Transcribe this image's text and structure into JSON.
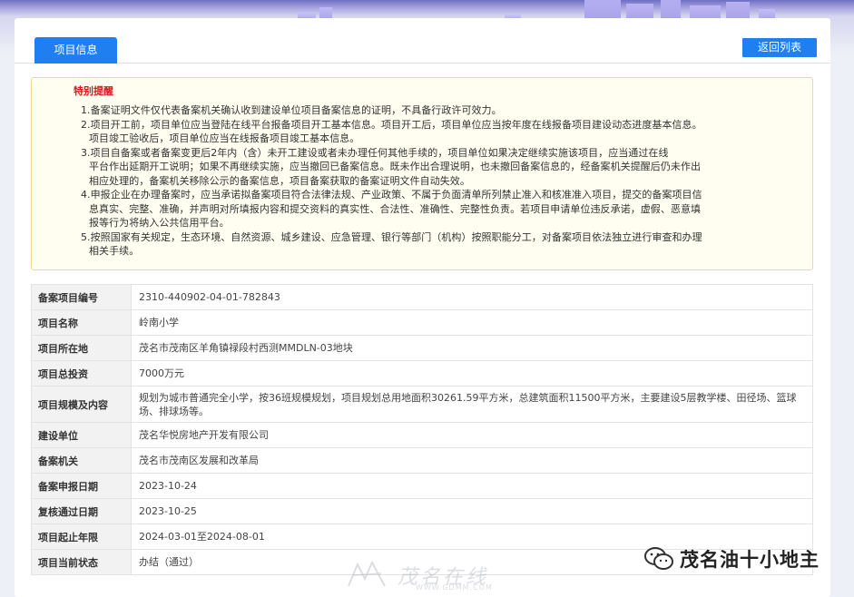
{
  "tabs": {
    "active_label": "项目信息",
    "back_label": "返回列表"
  },
  "notice": {
    "title": "特别提醒",
    "lines": [
      "1.备案证明文件仅代表备案机关确认收到建设单位项目备案信息的证明，不具备行政许可效力。",
      "2.项目开工前，项目单位应当登陆在线平台报备项目开工基本信息。项目开工后，项目单位应当按年度在线报备项目建设动态进度基本信息。",
      "项目竣工验收后，项目单位应当在线报备项目竣工基本信息。",
      "3.项目自备案或者备案变更后2年内（含）未开工建设或者未办理任何其他手续的，项目单位如果决定继续实施该项目，应当通过在线",
      "平台作出延期开工说明；如果不再继续实施，应当撤回已备案信息。既未作出合理说明，也未撤回备案信息的，经备案机关提醒后仍未作出",
      "相应处理的，备案机关移除公示的备案信息，项目备案获取的备案证明文件自动失效。",
      "4.申报企业在办理备案时，应当承诺拟备案项目符合法律法规、产业政策、不属于负面清单所列禁止准入和核准准入项目，提交的备案项目信",
      "息真实、完整、准确，并声明对所填报内容和提交资料的真实性、合法性、准确性、完整性负责。若项目申请单位违反承诺，虚假、恶意填",
      "报等行为将纳入公共信用平台。",
      "5.按照国家有关规定，生态环境、自然资源、城乡建设、应急管理、银行等部门（机构）按照职能分工，对备案项目依法独立进行审查和办理",
      "相关手续。"
    ]
  },
  "info": {
    "rows": [
      {
        "label": "备案项目编号",
        "value": "2310-440902-04-01-782843"
      },
      {
        "label": "项目名称",
        "value": "岭南小学"
      },
      {
        "label": "项目所在地",
        "value": "茂名市茂南区羊角镇禄段村西测MMDLN-03地块"
      },
      {
        "label": "项目总投资",
        "value": "7000万元"
      },
      {
        "label": "项目规模及内容",
        "value": "规划为城市普通完全小学，按36班规模规划，项目规划总用地面积30261.59平方米，总建筑面积11500平方米，主要建设5层教学楼、田径场、篮球场、排球场等。"
      },
      {
        "label": "建设单位",
        "value": "茂名华悦房地产开发有限公司"
      },
      {
        "label": "备案机关",
        "value": "茂名市茂南区发展和改革局"
      },
      {
        "label": "备案申报日期",
        "value": "2023-10-24"
      },
      {
        "label": "复核通过日期",
        "value": "2023-10-25"
      },
      {
        "label": "项目起止年限",
        "value": "2024-03-01至2024-08-01"
      },
      {
        "label": "项目当前状态",
        "value": "办结（通过）"
      }
    ]
  },
  "watermarks": {
    "site_name": "茂名在线",
    "site_url": "WWW.GDMM.COM",
    "wechat_account": "茂名油十小地主",
    "wechat_icon": "wechat-icon"
  },
  "colors": {
    "accent": "#1f7ff0",
    "notice_title": "#d2161e",
    "notice_bg": "#fffef1",
    "notice_border": "#f3d98a"
  }
}
